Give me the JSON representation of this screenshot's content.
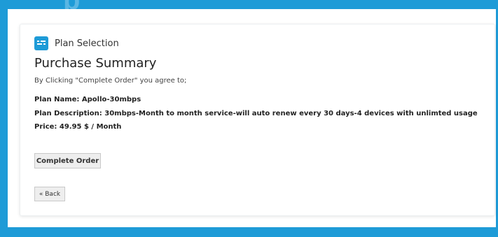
{
  "page": {
    "partial_heading": "p"
  },
  "card": {
    "header_label": "Plan Selection",
    "title": "Purchase Summary",
    "agreement_text": "By Clicking \"Complete Order\" you agree to;",
    "plan_name": "Plan Name: Apollo-30mbps",
    "plan_description": "Plan Description: 30mbps-Month to month service-will auto renew every 30 days-4 devices with unlimted usage",
    "price": "Price: 49.95 $ / Month",
    "complete_order_label": "Complete Order",
    "back_label": "« Back"
  },
  "colors": {
    "accent": "#1e9bd7",
    "button_bg": "#eeeeee"
  },
  "icons": {
    "header": "list-icon"
  }
}
